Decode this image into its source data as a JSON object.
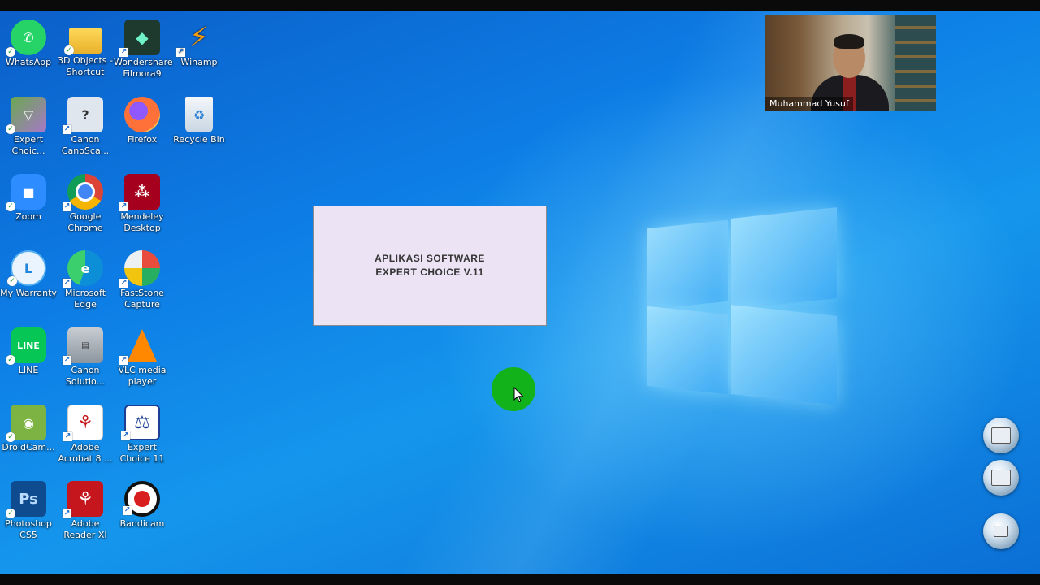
{
  "desktop_icons": [
    {
      "label": "WhatsApp",
      "icon": "whatsapp-icon",
      "color": "#25d366"
    },
    {
      "label": "3D Objects - Shortcut",
      "icon": "folder-icon",
      "color": "#f5c842"
    },
    {
      "label": "Wondershare Filmora9",
      "icon": "filmora-icon",
      "color": "#1e3a2f"
    },
    {
      "label": "Winamp",
      "icon": "winamp-icon",
      "color": "#f39c12"
    },
    {
      "label": "Expert Choic...",
      "icon": "expert-choice-icon",
      "color": "#6aa84f"
    },
    {
      "label": "Canon CanoSca...",
      "icon": "canon-canoscan-icon",
      "color": "#dfe6ee"
    },
    {
      "label": "Firefox",
      "icon": "firefox-icon",
      "color": "#ff7139"
    },
    {
      "label": "Recycle Bin",
      "icon": "recycle-bin-icon",
      "color": "#dfe9f2"
    },
    {
      "label": "Zoom",
      "icon": "zoom-icon",
      "color": "#2d8cff"
    },
    {
      "label": "Google Chrome",
      "icon": "chrome-icon",
      "color": "#db4437"
    },
    {
      "label": "Mendeley Desktop",
      "icon": "mendeley-icon",
      "color": "#a5001e"
    },
    {
      "label": "My Warranty",
      "icon": "my-warranty-icon",
      "color": "#e9f4ff"
    },
    {
      "label": "Microsoft Edge",
      "icon": "edge-icon",
      "color": "#0c8fd6"
    },
    {
      "label": "FastStone Capture",
      "icon": "faststone-icon",
      "color": "#e74c3c"
    },
    {
      "label": "LINE",
      "icon": "line-icon",
      "color": "#06c755"
    },
    {
      "label": "Canon Solutio...",
      "icon": "canon-solution-icon",
      "color": "#9aa4ad"
    },
    {
      "label": "VLC media player",
      "icon": "vlc-icon",
      "color": "#ff8800"
    },
    {
      "label": "DroidCam...",
      "icon": "droidcam-icon",
      "color": "#7cb342"
    },
    {
      "label": "Adobe Acrobat 8 ...",
      "icon": "acrobat-icon",
      "color": "#ffffff"
    },
    {
      "label": "Expert Choice 11",
      "icon": "expert-choice-11-icon",
      "color": "#1c3f94"
    },
    {
      "label": "Photoshop CS5",
      "icon": "photoshop-icon",
      "color": "#0f4b8f"
    },
    {
      "label": "Adobe Reader XI",
      "icon": "reader-icon",
      "color": "#c4161c"
    },
    {
      "label": "Bandicam",
      "icon": "bandicam-icon",
      "color": "#d81e1e"
    }
  ],
  "slide": {
    "line1": "APLIKASI SOFTWARE",
    "line2": "EXPERT CHOICE V.11"
  },
  "webcam": {
    "name": "Muhammad Yusuf"
  },
  "colors": {
    "cursor_halo": "#12b21b",
    "wallpaper": "#0d7ee6"
  }
}
